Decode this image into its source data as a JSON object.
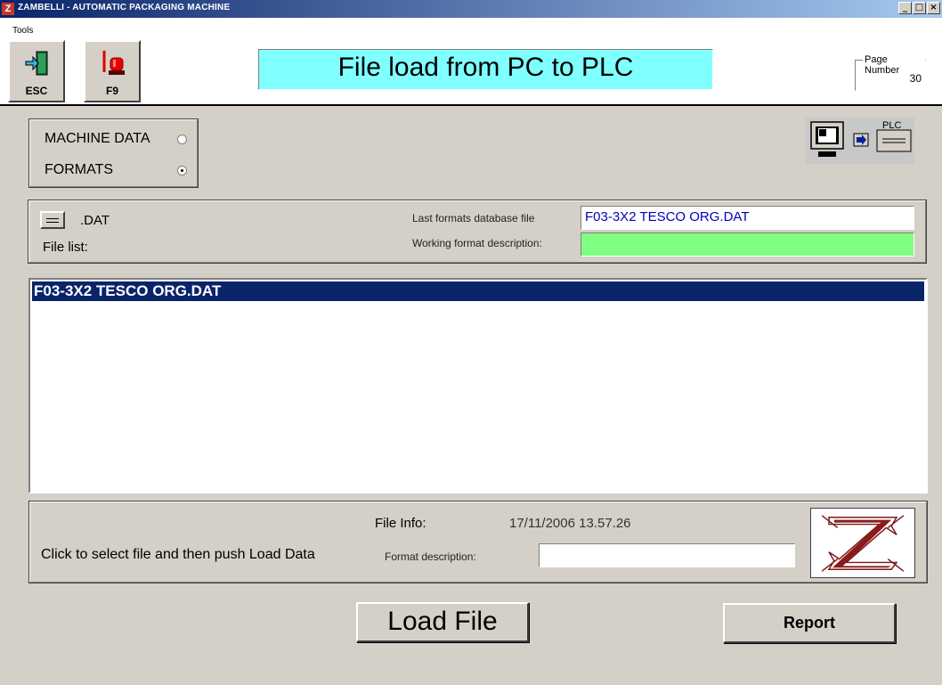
{
  "window": {
    "title": "ZAMBELLI - AUTOMATIC PACKAGING MACHINE",
    "app_icon_glyph": "Z",
    "min_glyph": "_",
    "max_glyph": "□",
    "close_glyph": "×"
  },
  "menu": {
    "tools": "Tools"
  },
  "toolbar": {
    "esc_label": "ESC",
    "f9_label": "F9"
  },
  "page_title": "File load from PC to PLC",
  "page_number": {
    "label": "Page Number",
    "value": "30"
  },
  "selection": {
    "machine_data_label": "MACHINE DATA",
    "machine_data_checked": false,
    "formats_label": "FORMATS",
    "formats_checked": true
  },
  "transfer_icon": {
    "plc_label": "PLC"
  },
  "file_panel": {
    "extension_label": ".DAT",
    "file_list_label": "File list:",
    "last_db_label": "Last formats database file",
    "last_db_value": "F03-3X2 TESCO ORG.DAT",
    "working_desc_label": "Working format description:",
    "working_desc_value": ""
  },
  "file_list": {
    "items": [
      "F03-3X2 TESCO ORG.DAT"
    ]
  },
  "info_panel": {
    "hint": "Click to select file and then push Load Data",
    "file_info_label": "File Info:",
    "file_info_value": "17/11/2006 13.57.26",
    "format_desc_label": "Format description:",
    "format_desc_value": ""
  },
  "actions": {
    "load_label": "Load File",
    "report_label": "Report"
  },
  "colors": {
    "title_bg": "#80ffff",
    "working_desc_bg": "#80ff80",
    "selected_row": "#0a246a",
    "file_text": "#0000c0"
  }
}
